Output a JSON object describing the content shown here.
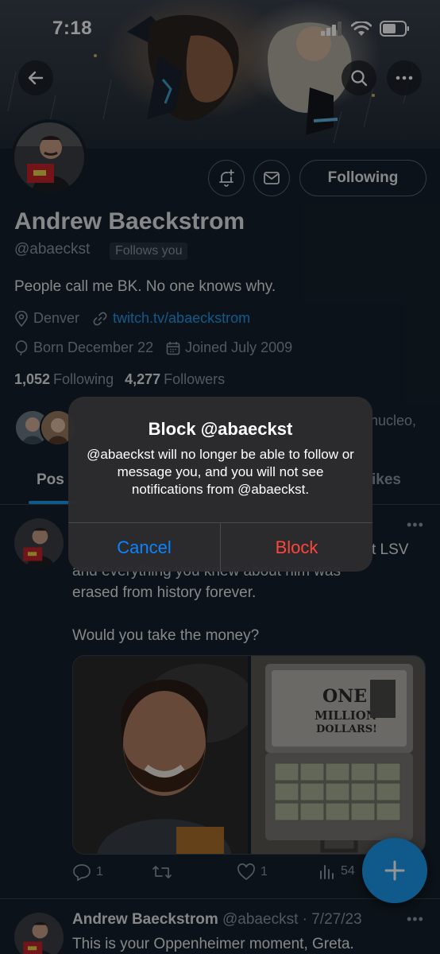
{
  "status_bar": {
    "time": "7:18"
  },
  "banner": {
    "description_icon": "banner-art-image"
  },
  "header": {
    "back_icon": "arrow-left-icon",
    "search_icon": "search-icon",
    "more_icon": "more-horizontal-icon"
  },
  "profile": {
    "display_name": "Andrew Baeckstrom",
    "handle": "@abaeckst",
    "follows_you": "Follows you",
    "bio": "People call me BK. No one knows why.",
    "location": "Denver",
    "website": "twitch.tv/abaeckstrom",
    "birthday": "Born December 22",
    "joined": "Joined July 2009",
    "following_count": "1,052",
    "following_label": "Following",
    "followers_count": "4,277",
    "followers_label": "Followers",
    "following_button": "Following",
    "followed_by_text": "nucleo,"
  },
  "tabs": [
    {
      "label": "Posts",
      "visible": "Pos"
    },
    {
      "label": "Likes",
      "visible": "ikes"
    }
  ],
  "tweets": [
    {
      "text_tail_line1": "t LSV",
      "text_partial_line2": "and everything you knew about him was",
      "text_line3": "erased from history forever.",
      "text_line4": "Would you take the money?",
      "media_briefcase_text_1": "ONE",
      "media_briefcase_text_2": "MILLION",
      "media_briefcase_text_3": "DOLLARS!",
      "replies": "1",
      "reposts": "",
      "likes": "1",
      "views": "54"
    },
    {
      "name": "Andrew Baeckstrom",
      "handle_date": "@abaeckst · 7/27/23",
      "text": "This is your Oppenheimer moment, Greta."
    }
  ],
  "fab": {
    "icon": "plus-icon"
  },
  "dialog": {
    "title": "Block @abaeckst",
    "message": "@abaeckst will no longer be able to follow or message you, and you will not see notifications from @abaeckst.",
    "cancel": "Cancel",
    "confirm": "Block"
  },
  "colors": {
    "background": "#15202b",
    "accent": "#1d9bf0",
    "secondary_text": "#8b98a5",
    "ios_blue": "#0a84ff",
    "ios_red": "#ff453a"
  }
}
